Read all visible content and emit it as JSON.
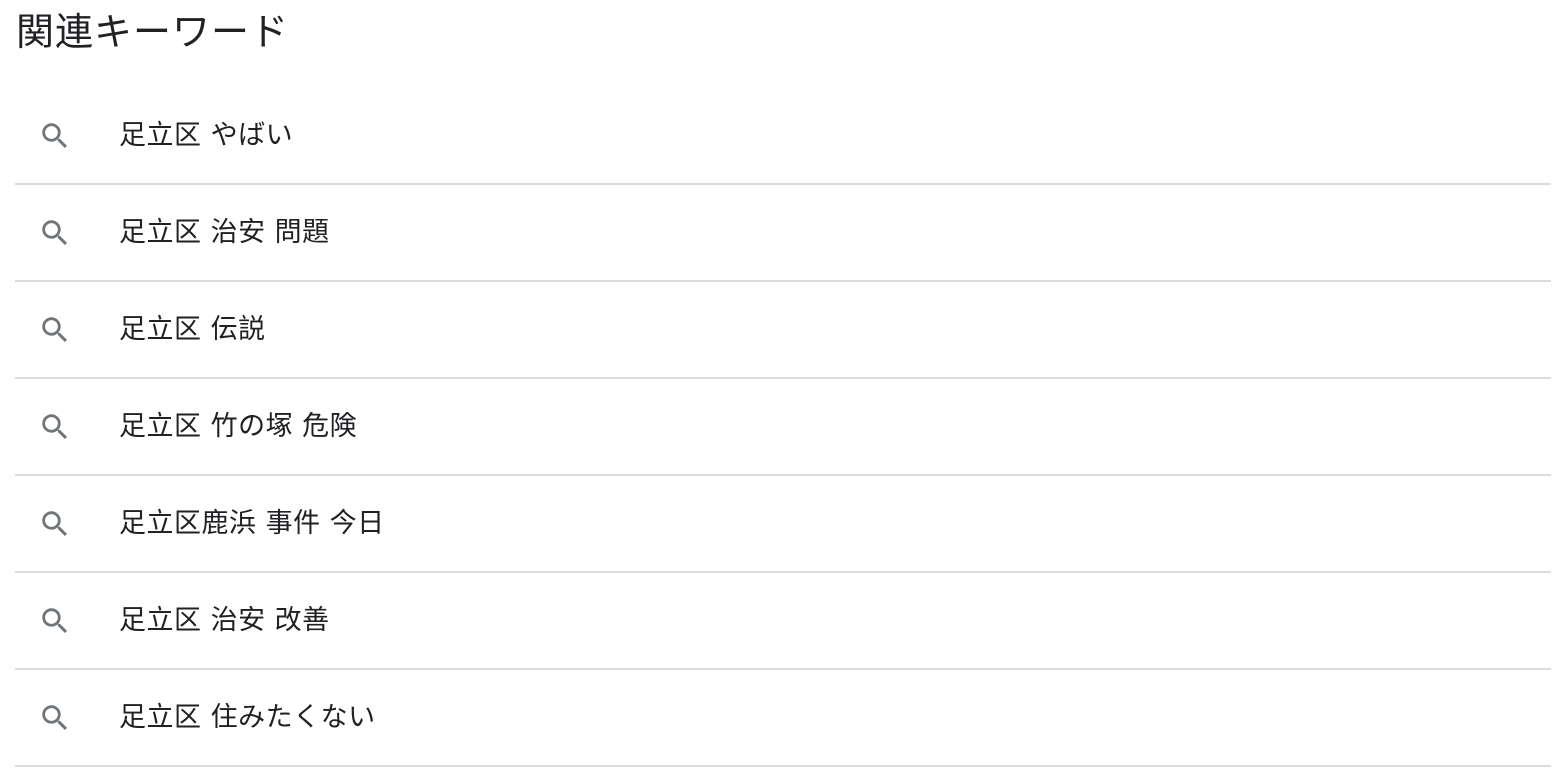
{
  "section": {
    "title": "関連キーワード"
  },
  "icons": {
    "item_icon": "search-icon",
    "icon_color": "#70757a"
  },
  "colors": {
    "text": "#202124",
    "divider": "#dadce0"
  },
  "related_keywords": [
    {
      "label": "足立区 やばい"
    },
    {
      "label": "足立区 治安 問題"
    },
    {
      "label": "足立区 伝説"
    },
    {
      "label": "足立区 竹の塚 危険"
    },
    {
      "label": "足立区鹿浜 事件 今日"
    },
    {
      "label": "足立区 治安 改善"
    },
    {
      "label": "足立区 住みたくない"
    }
  ]
}
